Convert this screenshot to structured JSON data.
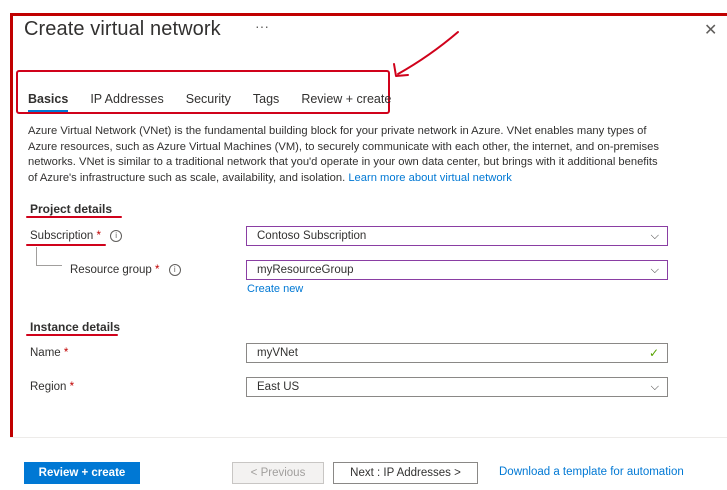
{
  "window": {
    "title": "Create virtual network",
    "more_label": "···",
    "close_label": "✕"
  },
  "tabs": [
    {
      "label": "Basics",
      "active": true
    },
    {
      "label": "IP Addresses",
      "active": false
    },
    {
      "label": "Security",
      "active": false
    },
    {
      "label": "Tags",
      "active": false
    },
    {
      "label": "Review + create",
      "active": false
    }
  ],
  "description": {
    "text": "Azure Virtual Network (VNet) is the fundamental building block for your private network in Azure. VNet enables many types of Azure resources, such as Azure Virtual Machines (VM), to securely communicate with each other, the internet, and on-premises networks. VNet is similar to a traditional network that you'd operate in your own data center, but brings with it additional benefits of Azure's infrastructure such as scale, availability, and isolation.",
    "link": "Learn more about virtual network"
  },
  "project_details": {
    "heading": "Project details",
    "subscription": {
      "label": "Subscription",
      "required": "*",
      "info_icon": "i",
      "value": "Contoso Subscription",
      "chevron": "⌵"
    },
    "resource_group": {
      "label": "Resource group",
      "required": "*",
      "info_icon": "i",
      "value": "myResourceGroup",
      "chevron": "⌵",
      "create_new": "Create new"
    }
  },
  "instance_details": {
    "heading": "Instance details",
    "name": {
      "label": "Name",
      "required": "*",
      "value": "myVNet",
      "valid_icon": "✓"
    },
    "region": {
      "label": "Region",
      "required": "*",
      "value": "East US",
      "chevron": "⌵"
    }
  },
  "footer": {
    "review_create": "Review + create",
    "previous": "< Previous",
    "next": "Next : IP Addresses >",
    "download_link": "Download a template for automation"
  },
  "colors": {
    "accent": "#0078d4",
    "annotation": "#d0021b",
    "focus_border": "#8a3ea3",
    "valid": "#57a300"
  }
}
